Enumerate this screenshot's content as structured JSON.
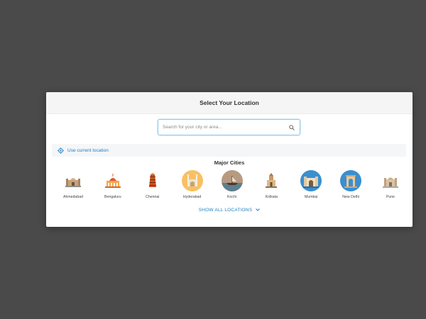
{
  "modal": {
    "title": "Select Your Location"
  },
  "search": {
    "placeholder": "Search for your city or area..."
  },
  "current_location": {
    "label": "Use current location"
  },
  "major_cities": {
    "title": "Major Cities",
    "items": [
      {
        "label": "Ahmedabad",
        "icon": "ahmedabad-monument-icon",
        "bg": "#ffffff"
      },
      {
        "label": "Bengaluru",
        "icon": "bengaluru-palace-icon",
        "bg": "#ffffff"
      },
      {
        "label": "Chennai",
        "icon": "chennai-temple-icon",
        "bg": "#ffffff"
      },
      {
        "label": "Hyderabad",
        "icon": "hyderabad-charminar-icon",
        "bg": "#f9c063"
      },
      {
        "label": "Kochi",
        "icon": "kochi-boat-icon",
        "bg": "#b89a80"
      },
      {
        "label": "Kolkata",
        "icon": "kolkata-monument-icon",
        "bg": "#ffffff"
      },
      {
        "label": "Mumbai",
        "icon": "mumbai-gateway-icon",
        "bg": "#3a8fd0"
      },
      {
        "label": "New Delhi",
        "icon": "delhi-india-gate-icon",
        "bg": "#3a8fd0"
      },
      {
        "label": "Pune",
        "icon": "pune-fort-icon",
        "bg": "#ffffff"
      }
    ]
  },
  "show_all": {
    "label": "SHOW ALL LOCATIONS"
  },
  "colors": {
    "accent": "#1f7fbf",
    "backdrop": "#4a4a4a",
    "search_border": "#8fc9e6"
  }
}
